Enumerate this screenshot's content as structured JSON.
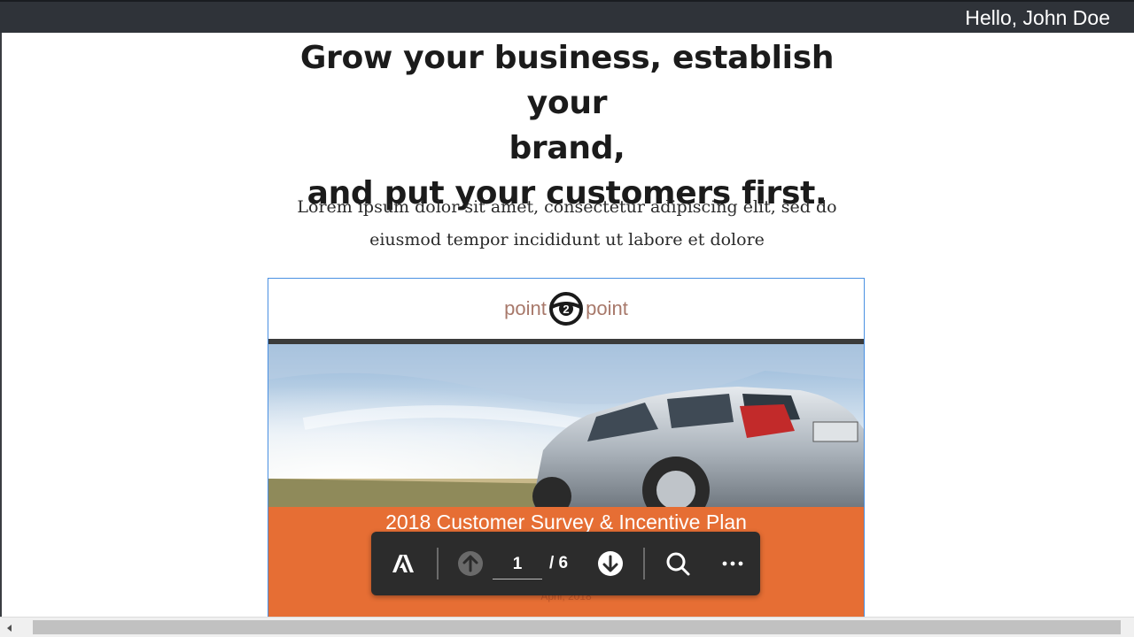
{
  "header": {
    "greeting": "Hello, John Doe",
    "bg_color": "#2f3339"
  },
  "hero": {
    "headline_lines": [
      "Grow your business, establish your",
      "brand,",
      "and put your customers first."
    ],
    "subtext_lines": [
      "Lorem ipsum dolor sit amet, consectetur adipiscing elit, sed do",
      "eiusmod tempor incididunt ut labore et dolore"
    ]
  },
  "pdf": {
    "brand_left": "point",
    "brand_mark": "2",
    "brand_right": "point",
    "document_title": "2018 Customer Survey & Incentive Plan",
    "document_date": "April, 2018",
    "accent_color": "#e66e34",
    "brand_color": "#a8796b",
    "toolbar": {
      "adobe_icon": "adobe-icon",
      "prev_icon": "arrow-up-circle-icon",
      "next_icon": "arrow-down-circle-icon",
      "search_icon": "search-icon",
      "more_icon": "more-horizontal-icon",
      "current_page": "1",
      "total_pages": "/ 6"
    }
  },
  "scrollbar": {
    "left_arrow_icon": "scroll-left-arrow-icon"
  }
}
